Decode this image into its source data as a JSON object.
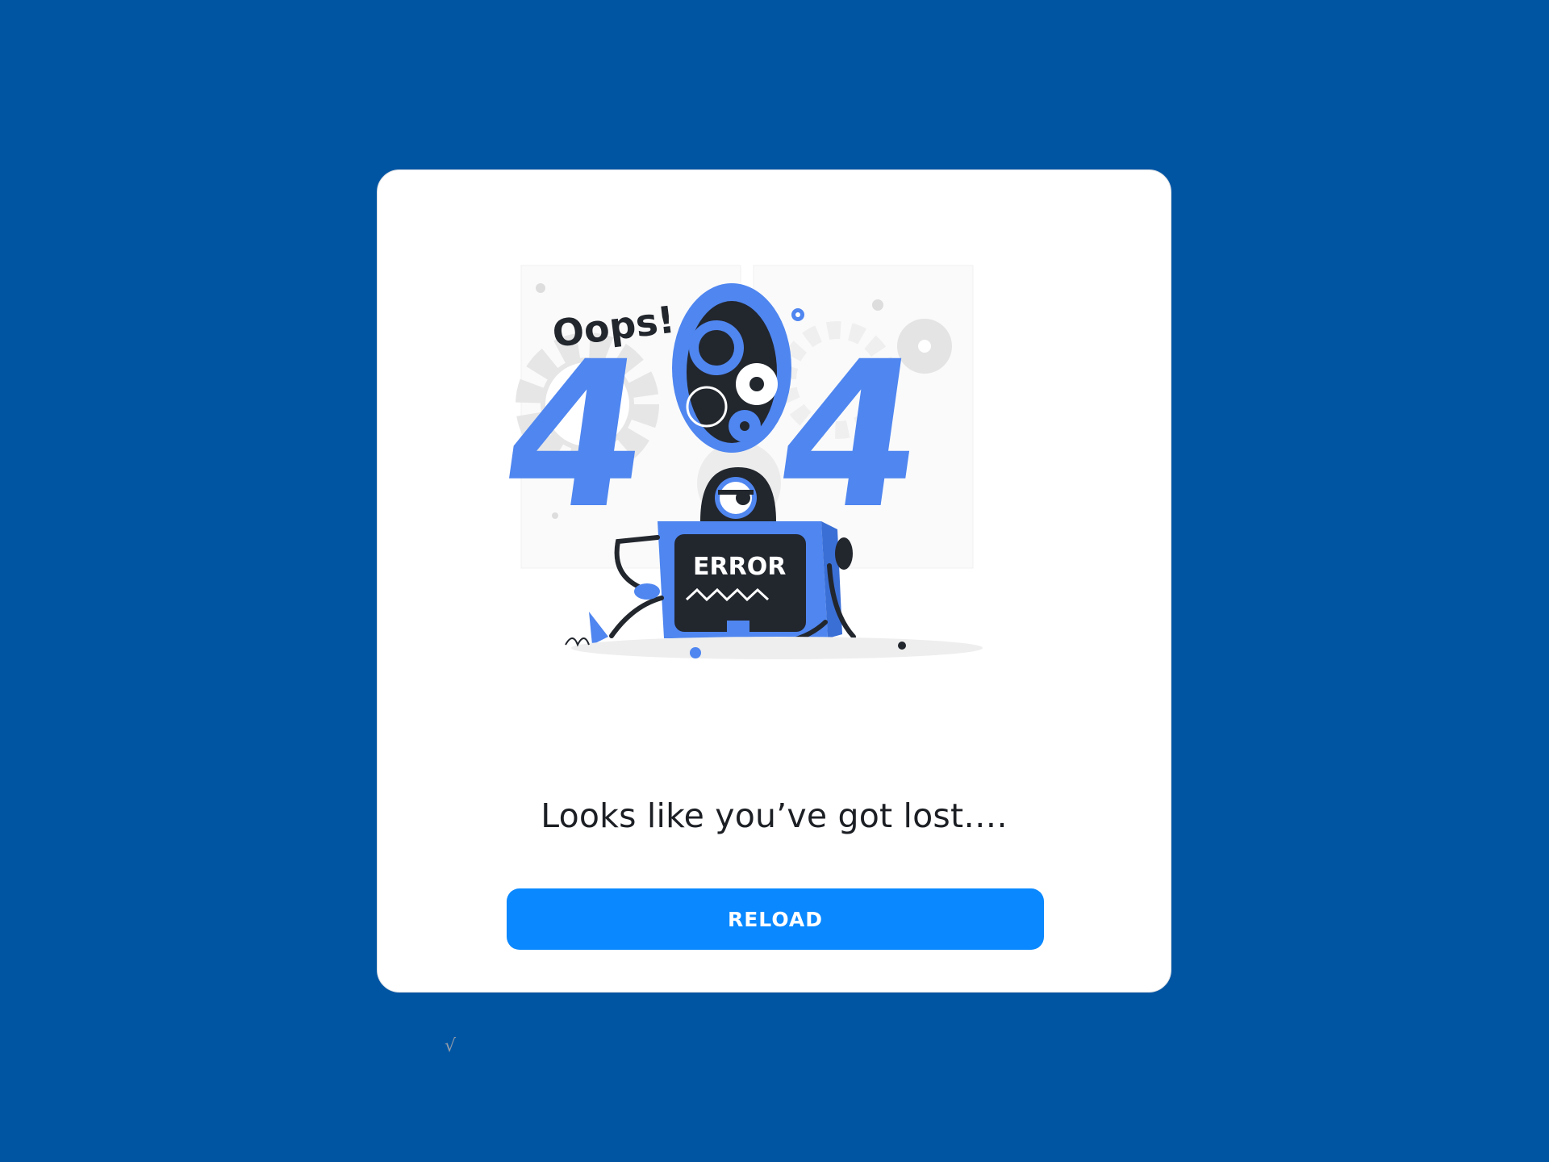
{
  "illustration": {
    "oops": "Oops!",
    "digit_left": "4",
    "digit_right": "4",
    "screen_text": "ERROR"
  },
  "message": "Looks like you’ve got lost….",
  "reload_label": "RELOAD",
  "footer_mark": "√",
  "colors": {
    "background": "#0055a3",
    "card": "#ffffff",
    "button": "#0a88ff",
    "illustration_blue": "#4f86f0",
    "illustration_dark": "#22262d"
  }
}
